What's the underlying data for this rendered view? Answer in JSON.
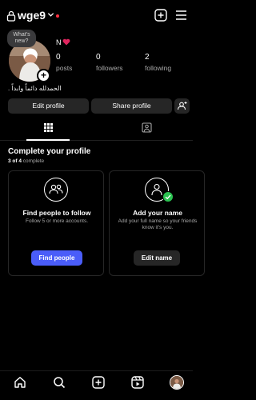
{
  "header": {
    "username": "wge9",
    "icons": [
      "lock-icon",
      "chevron-down-icon",
      "notification-dot",
      "create-icon",
      "menu-icon"
    ]
  },
  "profile": {
    "note": "What's new?",
    "display_name": "N",
    "bio": "الحمدلله دائماً وابداً .",
    "stats": [
      {
        "value": "0",
        "label": "posts"
      },
      {
        "value": "0",
        "label": "followers"
      },
      {
        "value": "2",
        "label": "following"
      }
    ]
  },
  "actions": {
    "edit_label": "Edit profile",
    "share_label": "Share profile"
  },
  "tabs": [
    "grid-icon",
    "tagged-icon"
  ],
  "complete_profile": {
    "title": "Complete your profile",
    "progress_count": "3 of 4",
    "progress_word": "complete",
    "progress": 0.75,
    "cards": [
      {
        "title": "Find people to follow",
        "desc": "Follow 5 or more accounts.",
        "button": "Find people"
      },
      {
        "title": "Add your name",
        "desc": "Add your full name so your friends know it's you.",
        "button": "Edit name"
      }
    ]
  },
  "bottom_nav": [
    "home-icon",
    "search-icon",
    "create-icon",
    "reels-icon",
    "profile-avatar"
  ],
  "colors": {
    "background": "#000000",
    "accent_blue": "#4a5df9",
    "button_dark": "#262626",
    "notification_red": "#ff3040",
    "check_green": "#2bc251"
  }
}
